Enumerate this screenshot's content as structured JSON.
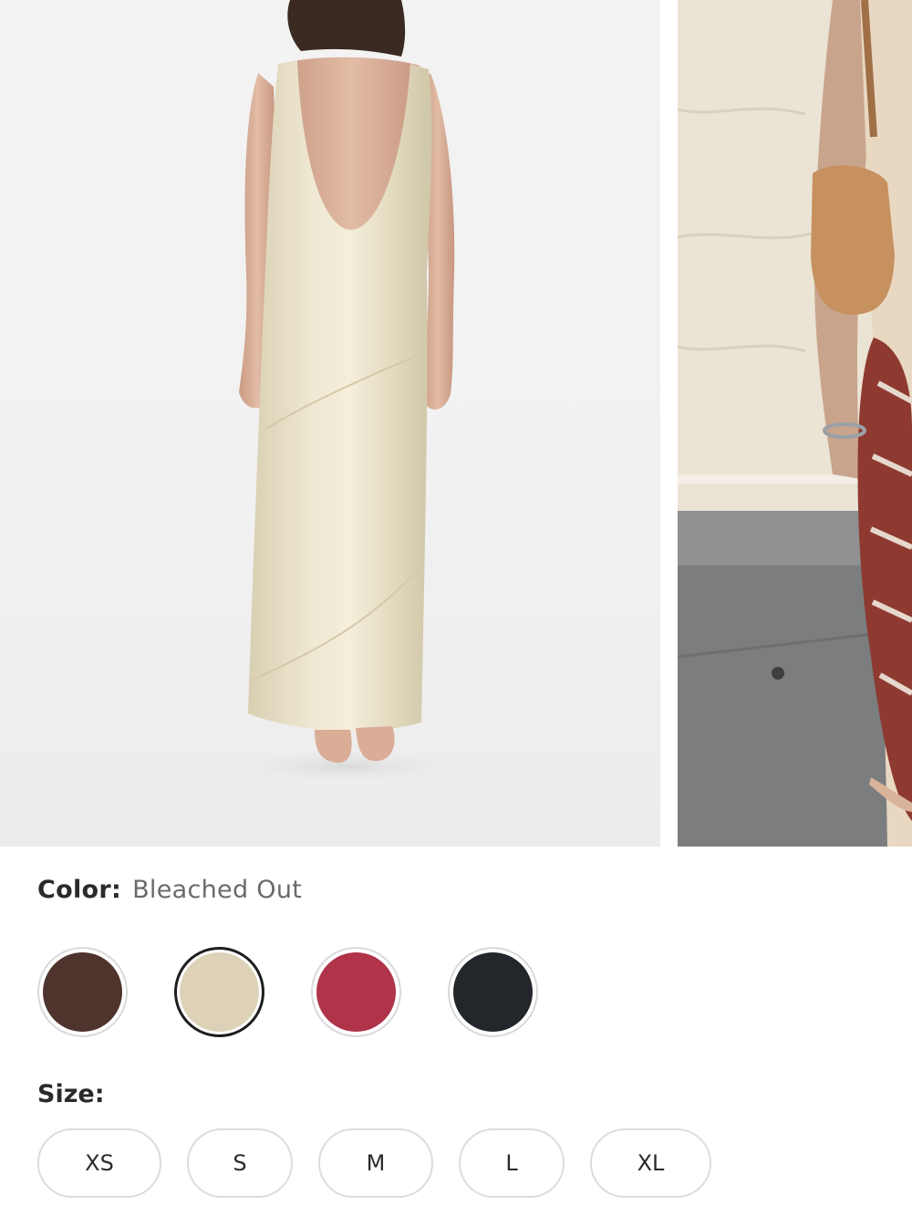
{
  "gallery": {
    "main_image": "dress-back-view",
    "side_image": "dress-street-view"
  },
  "color": {
    "label": "Color:",
    "selected": "Bleached Out",
    "swatches": [
      {
        "name": "brown",
        "hex": "#4e342c"
      },
      {
        "name": "bleached-out",
        "hex": "#ddd2b8"
      },
      {
        "name": "red",
        "hex": "#b0334a"
      },
      {
        "name": "black",
        "hex": "#23262b"
      }
    ]
  },
  "size": {
    "label": "Size:",
    "options": [
      "XS",
      "S",
      "M",
      "L",
      "XL"
    ]
  }
}
